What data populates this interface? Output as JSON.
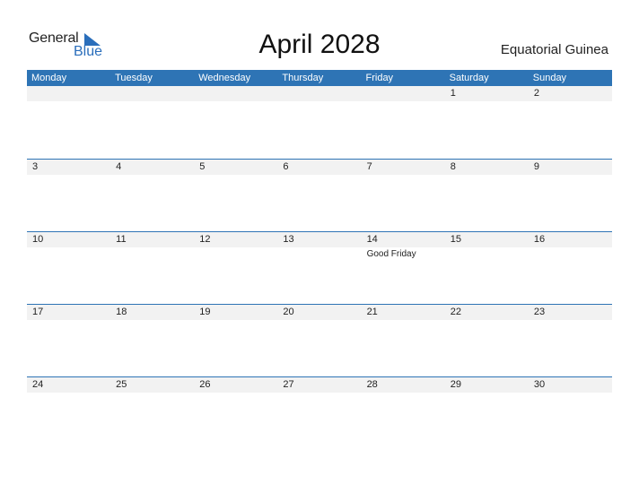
{
  "logo": {
    "general": "General",
    "blue": "Blue"
  },
  "title": "April 2028",
  "country": "Equatorial Guinea",
  "colors": {
    "accent": "#2e74b5",
    "strip": "#f2f2f2"
  },
  "weekdays": [
    "Monday",
    "Tuesday",
    "Wednesday",
    "Thursday",
    "Friday",
    "Saturday",
    "Sunday"
  ],
  "weeks": [
    [
      {
        "day": ""
      },
      {
        "day": ""
      },
      {
        "day": ""
      },
      {
        "day": ""
      },
      {
        "day": ""
      },
      {
        "day": "1"
      },
      {
        "day": "2"
      }
    ],
    [
      {
        "day": "3"
      },
      {
        "day": "4"
      },
      {
        "day": "5"
      },
      {
        "day": "6"
      },
      {
        "day": "7"
      },
      {
        "day": "8"
      },
      {
        "day": "9"
      }
    ],
    [
      {
        "day": "10"
      },
      {
        "day": "11"
      },
      {
        "day": "12"
      },
      {
        "day": "13"
      },
      {
        "day": "14",
        "holiday": "Good Friday"
      },
      {
        "day": "15"
      },
      {
        "day": "16"
      }
    ],
    [
      {
        "day": "17"
      },
      {
        "day": "18"
      },
      {
        "day": "19"
      },
      {
        "day": "20"
      },
      {
        "day": "21"
      },
      {
        "day": "22"
      },
      {
        "day": "23"
      }
    ],
    [
      {
        "day": "24"
      },
      {
        "day": "25"
      },
      {
        "day": "26"
      },
      {
        "day": "27"
      },
      {
        "day": "28"
      },
      {
        "day": "29"
      },
      {
        "day": "30"
      }
    ]
  ]
}
